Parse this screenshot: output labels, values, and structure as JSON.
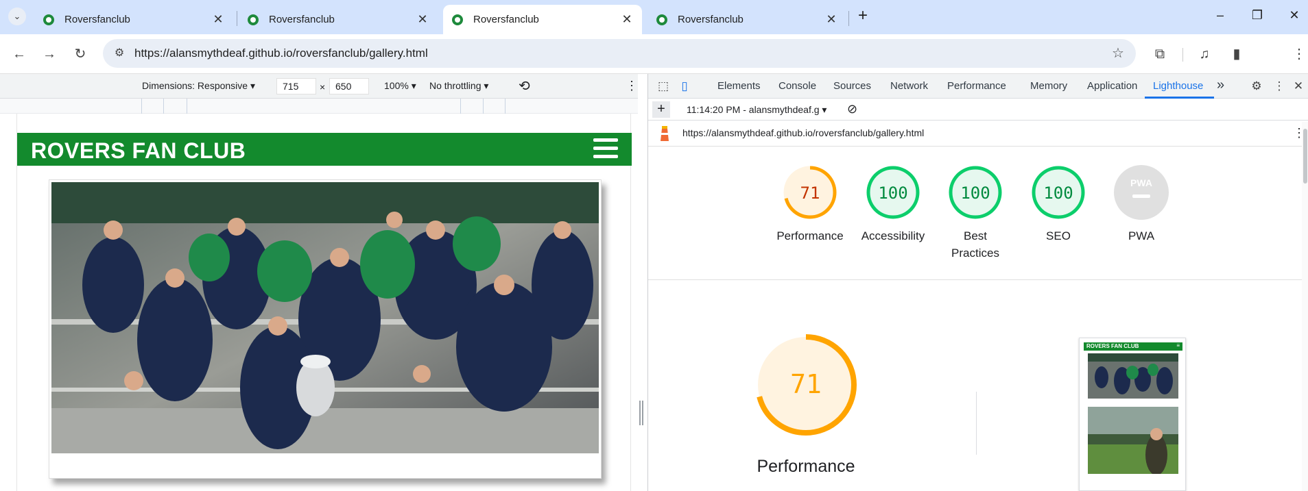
{
  "browser": {
    "tabs": [
      {
        "title": "Roversfanclub",
        "active": false
      },
      {
        "title": "Roversfanclub",
        "active": false
      },
      {
        "title": "Roversfanclub",
        "active": true
      },
      {
        "title": "Roversfanclub",
        "active": false
      }
    ],
    "url": "https://alansmythdeaf.github.io/roversfanclub/gallery.html"
  },
  "device_toolbar": {
    "dimensions_label": "Dimensions: Responsive",
    "width": "715",
    "times": "×",
    "height": "650",
    "zoom": "100%",
    "throttling": "No throttling"
  },
  "site": {
    "brand": "ROVERS FAN CLUB",
    "photo_alt": "Team celebrating with trophy"
  },
  "devtools": {
    "tabs": [
      "Elements",
      "Console",
      "Sources",
      "Network",
      "Performance",
      "Memory",
      "Application",
      "Lighthouse"
    ],
    "active_tab": "Lighthouse",
    "overflow": "»",
    "report_selector": "11:14:20 PM - alansmythdeaf.g",
    "report_url": "https://alansmythdeaf.github.io/roversfanclub/gallery.html",
    "scores": [
      {
        "label": "Performance",
        "value": "71",
        "fraction": 0.71,
        "status": "average"
      },
      {
        "label": "Accessibility",
        "value": "100",
        "fraction": 1.0,
        "status": "pass"
      },
      {
        "label": "Best Practices",
        "value": "100",
        "fraction": 1.0,
        "status": "pass"
      },
      {
        "label": "SEO",
        "value": "100",
        "fraction": 1.0,
        "status": "pass"
      },
      {
        "label": "PWA",
        "value": "PWA",
        "fraction": 0,
        "status": "na"
      }
    ],
    "main_score": {
      "label": "Performance",
      "value": "71",
      "fraction": 0.71
    },
    "thumb_brand": "ROVERS FAN CLUB"
  },
  "colors": {
    "brand_green": "#138a2d",
    "score_average": "#ffa400",
    "score_pass": "#0cce6b",
    "accent_blue": "#1a73e8"
  }
}
